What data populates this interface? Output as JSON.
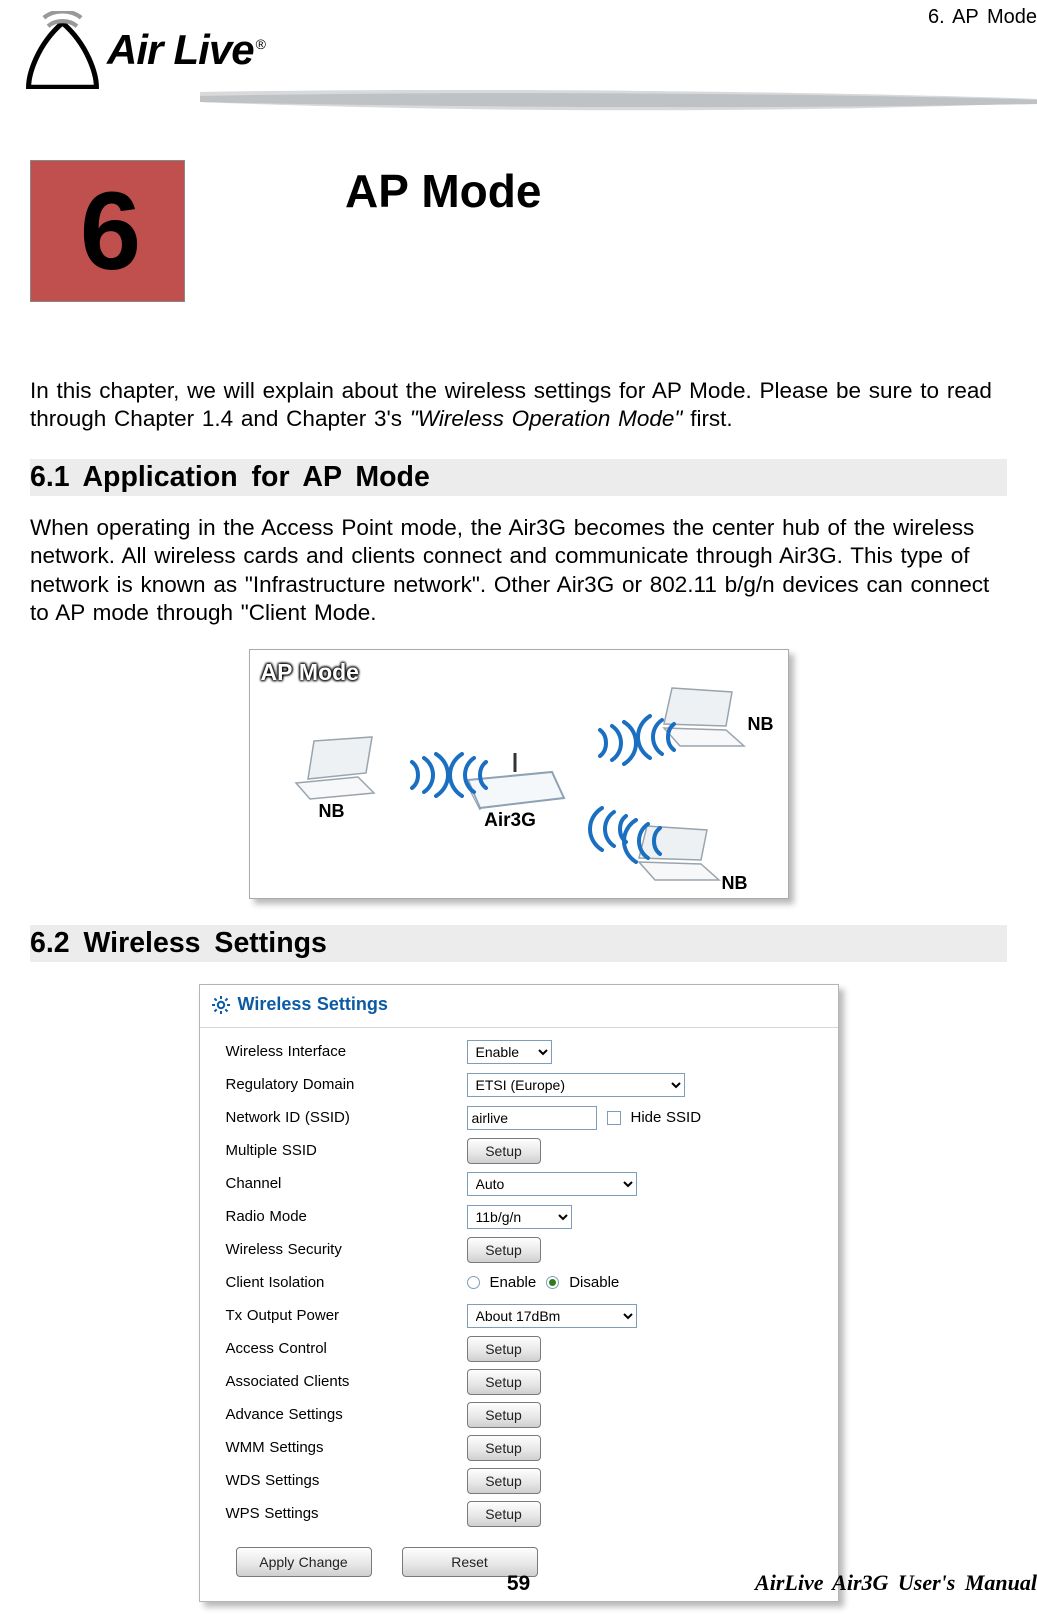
{
  "header": {
    "crumb": "6.    AP  Mode",
    "logo_text": "Air Live",
    "registered": "®"
  },
  "chapter": {
    "number": "6",
    "title": "AP Mode"
  },
  "intro": {
    "text_a": "In this chapter, we will explain about the wireless settings for AP Mode.    Please be sure to read through Chapter 1.4 and Chapter 3's ",
    "italic": "\"Wireless Operation Mode\"",
    "text_b": " first."
  },
  "section61": {
    "heading": "6.1 Application  for  AP  Mode",
    "para": "When operating in the Access Point mode, the Air3G becomes the center hub of the wireless network.    All wireless cards and clients connect and communicate through Air3G. This type of network is known as \"Infrastructure network\".    Other Air3G or 802.11 b/g/n devices can connect to AP mode through \"Client Mode."
  },
  "diagram": {
    "title": "AP Mode",
    "router_label": "Air3G",
    "nb1": "NB",
    "nb2": "NB",
    "nb3": "NB"
  },
  "section62": {
    "heading": "6.2 Wireless  Settings"
  },
  "panel": {
    "title": "Wireless Settings",
    "rows": {
      "wireless_interface": {
        "label": "Wireless Interface",
        "value": "Enable"
      },
      "regulatory": {
        "label": "Regulatory Domain",
        "value": "ETSI (Europe)"
      },
      "ssid": {
        "label": "Network ID (SSID)",
        "value": "airlive",
        "hide_label": "Hide SSID"
      },
      "multi_ssid": {
        "label": "Multiple SSID",
        "btn": "Setup"
      },
      "channel": {
        "label": "Channel",
        "value": "Auto"
      },
      "radio": {
        "label": "Radio Mode",
        "value": "11b/g/n"
      },
      "security": {
        "label": "Wireless Security",
        "btn": "Setup"
      },
      "isolation": {
        "label": "Client Isolation",
        "enable": "Enable",
        "disable": "Disable"
      },
      "txpower": {
        "label": "Tx Output Power",
        "value": "About 17dBm"
      },
      "access": {
        "label": "Access Control",
        "btn": "Setup"
      },
      "clients": {
        "label": "Associated Clients",
        "btn": "Setup"
      },
      "advance": {
        "label": "Advance Settings",
        "btn": "Setup"
      },
      "wmm": {
        "label": "WMM Settings",
        "btn": "Setup"
      },
      "wds": {
        "label": "WDS Settings",
        "btn": "Setup"
      },
      "wps": {
        "label": "WPS Settings",
        "btn": "Setup"
      }
    },
    "footer": {
      "apply": "Apply Change",
      "reset": "Reset"
    }
  },
  "footer": {
    "page": "59",
    "manual": "AirLive  Air3G  User's  Manual"
  }
}
